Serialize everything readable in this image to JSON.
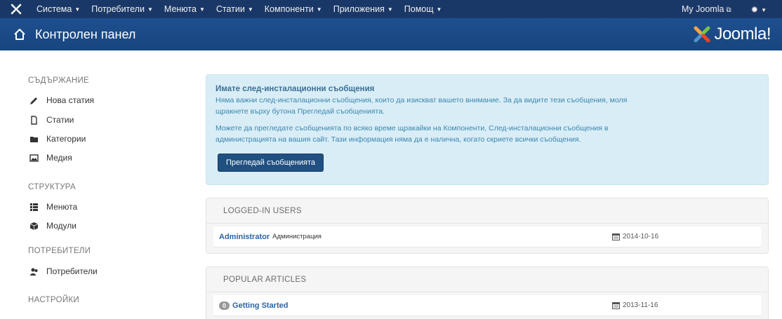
{
  "navbar": {
    "logo_icon": "joomla-x-icon",
    "menu": [
      {
        "label": "Система"
      },
      {
        "label": "Потребители"
      },
      {
        "label": "Менюта"
      },
      {
        "label": "Статии"
      },
      {
        "label": "Компоненти"
      },
      {
        "label": "Приложения"
      },
      {
        "label": "Помощ"
      }
    ],
    "site_link": "My Joomla",
    "settings_icon": "gear-icon"
  },
  "header": {
    "title": "Контролен панел",
    "brand": "Joomla!",
    "home_icon": "home-icon",
    "colors": {
      "navbar": "#1a3867",
      "header": "#1e4f8f"
    }
  },
  "sidebar": {
    "sections": [
      {
        "heading": "СЪДЪРЖАНИЕ",
        "items": [
          {
            "label": "Нова статия",
            "icon": "pencil-icon"
          },
          {
            "label": "Статии",
            "icon": "file-icon"
          },
          {
            "label": "Категории",
            "icon": "folder-icon"
          },
          {
            "label": "Медия",
            "icon": "image-icon"
          }
        ]
      },
      {
        "heading": "СТРУКТУРА",
        "items": [
          {
            "label": "Менюта",
            "icon": "list-icon"
          },
          {
            "label": "Модули",
            "icon": "cube-icon"
          }
        ]
      },
      {
        "heading": "ПОТРЕБИТЕЛИ",
        "items": [
          {
            "label": "Потребители",
            "icon": "users-icon"
          }
        ]
      },
      {
        "heading": "НАСТРОЙКИ",
        "items": []
      }
    ]
  },
  "alert": {
    "title": "Имате след-инсталационни съобщения",
    "line1": "Няма важни след-инсталационни съобщения, които да изискват вашето внимание. За да видите тези съобщения, моля",
    "line2": "щракнете върху бутона Прегледай съобщенията.",
    "line3": "Можете да прегледате съобщенията по всяко време щракайки на Компоненти, След-инсталационни съобщения в",
    "line4": "администрацията на вашия сайт. Тази информация няма да е налична, когато скриете всички съобщения.",
    "button": "Прегледай съобщенията",
    "colors": {
      "background": "#d9edf7",
      "button": "#205081"
    }
  },
  "logged_in": {
    "title": "LOGGED-IN USERS",
    "rows": [
      {
        "name": "Administrator",
        "role": "Администрация",
        "date": "2014-10-16"
      }
    ]
  },
  "popular": {
    "title": "POPULAR ARTICLES",
    "rows": [
      {
        "hits": "0",
        "title": "Getting Started",
        "date": "2013-11-16"
      }
    ]
  }
}
